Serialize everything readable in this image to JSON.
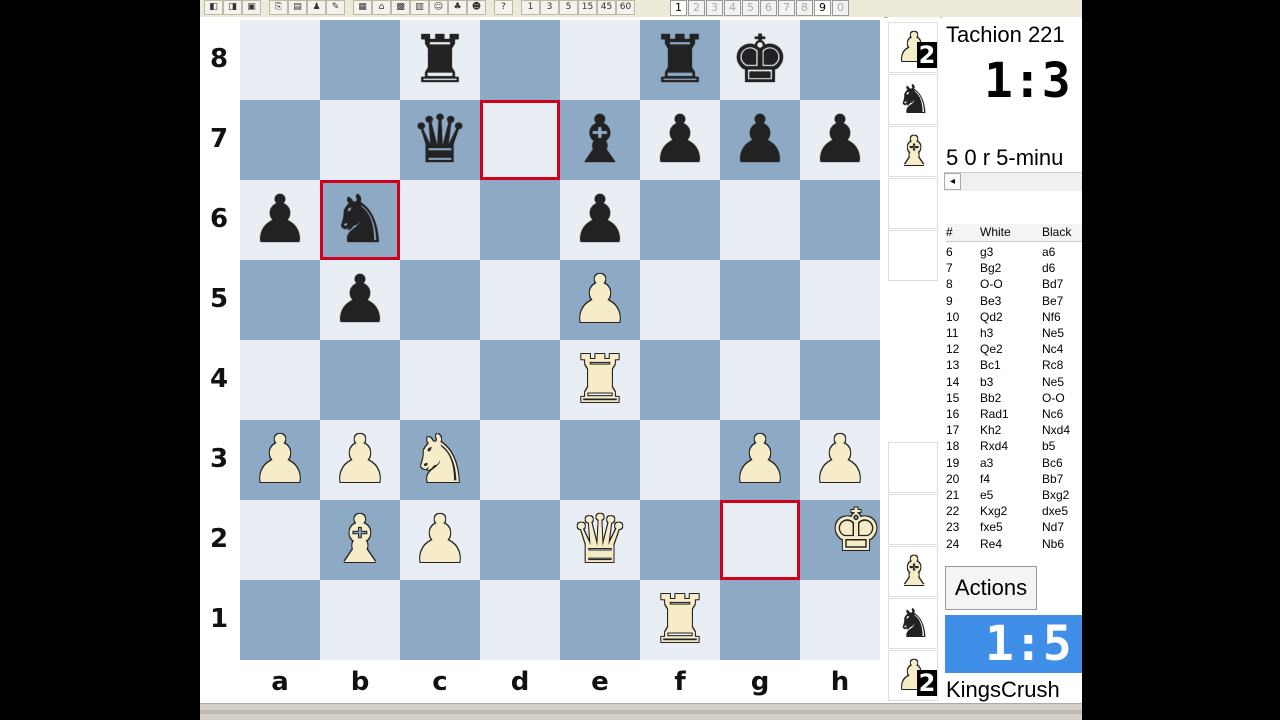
{
  "toolbar": {
    "icons": [
      {
        "name": "new-game-icon",
        "glyph": "◧"
      },
      {
        "name": "open-icon",
        "glyph": "◨"
      },
      {
        "name": "save-icon",
        "glyph": "▣"
      },
      {
        "name": "copy-icon",
        "glyph": "⎘"
      },
      {
        "name": "paste-icon",
        "glyph": "▤"
      },
      {
        "name": "engine-icon",
        "glyph": "♟"
      },
      {
        "name": "edit-icon",
        "glyph": "✎"
      },
      {
        "name": "list-icon",
        "glyph": "▦"
      },
      {
        "name": "home-icon",
        "glyph": "⌂"
      },
      {
        "name": "grid-icon",
        "glyph": "▩"
      },
      {
        "name": "board-icon",
        "glyph": "▥"
      },
      {
        "name": "person-icon",
        "glyph": "☺"
      },
      {
        "name": "tree-icon",
        "glyph": "♣"
      },
      {
        "name": "user-icon",
        "glyph": "☻"
      },
      {
        "name": "help-icon",
        "glyph": "?"
      },
      {
        "name": "level-1-icon",
        "glyph": "1"
      },
      {
        "name": "level-3-icon",
        "glyph": "3"
      },
      {
        "name": "level-5-icon",
        "glyph": "5"
      },
      {
        "name": "level-15-icon",
        "glyph": "15"
      },
      {
        "name": "level-45-icon",
        "glyph": "45"
      },
      {
        "name": "level-60-icon",
        "glyph": "60"
      }
    ],
    "numbers": [
      "1",
      "2",
      "3",
      "4",
      "5",
      "6",
      "7",
      "8",
      "9",
      "0"
    ],
    "active_numbers": [
      "1",
      "9"
    ]
  },
  "board": {
    "ranks": [
      "8",
      "7",
      "6",
      "5",
      "4",
      "3",
      "2",
      "1"
    ],
    "files": [
      "a",
      "b",
      "c",
      "d",
      "e",
      "f",
      "g",
      "h"
    ],
    "pieces": [
      {
        "sq": "c8",
        "color": "black",
        "glyph": "♜",
        "name": "black-rook-icon"
      },
      {
        "sq": "f8",
        "color": "black",
        "glyph": "♜",
        "name": "black-rook-icon"
      },
      {
        "sq": "g8",
        "color": "black",
        "glyph": "♚",
        "name": "black-king-icon"
      },
      {
        "sq": "c7",
        "color": "black",
        "glyph": "♛",
        "name": "black-queen-icon"
      },
      {
        "sq": "e7",
        "color": "black",
        "glyph": "♝",
        "name": "black-bishop-icon"
      },
      {
        "sq": "f7",
        "color": "black",
        "glyph": "♟",
        "name": "black-pawn-icon"
      },
      {
        "sq": "g7",
        "color": "black",
        "glyph": "♟",
        "name": "black-pawn-icon"
      },
      {
        "sq": "h7",
        "color": "black",
        "glyph": "♟",
        "name": "black-pawn-icon"
      },
      {
        "sq": "a6",
        "color": "black",
        "glyph": "♟",
        "name": "black-pawn-icon"
      },
      {
        "sq": "b6",
        "color": "black",
        "glyph": "♞",
        "name": "black-knight-icon"
      },
      {
        "sq": "e6",
        "color": "black",
        "glyph": "♟",
        "name": "black-pawn-icon"
      },
      {
        "sq": "b5",
        "color": "black",
        "glyph": "♟",
        "name": "black-pawn-icon"
      },
      {
        "sq": "e5",
        "color": "white",
        "glyph": "♟",
        "name": "white-pawn-icon"
      },
      {
        "sq": "e4",
        "color": "white",
        "glyph": "♜",
        "name": "white-rook-icon"
      },
      {
        "sq": "a3",
        "color": "white",
        "glyph": "♟",
        "name": "white-pawn-icon"
      },
      {
        "sq": "b3",
        "color": "white",
        "glyph": "♟",
        "name": "white-pawn-icon"
      },
      {
        "sq": "c3",
        "color": "white",
        "glyph": "♞",
        "name": "white-knight-icon"
      },
      {
        "sq": "g3",
        "color": "white",
        "glyph": "♟",
        "name": "white-pawn-icon"
      },
      {
        "sq": "h3",
        "color": "white",
        "glyph": "♟",
        "name": "white-pawn-icon"
      },
      {
        "sq": "b2",
        "color": "white",
        "glyph": "♝",
        "name": "white-bishop-icon"
      },
      {
        "sq": "c2",
        "color": "white",
        "glyph": "♟",
        "name": "white-pawn-icon"
      },
      {
        "sq": "e2",
        "color": "white",
        "glyph": "♛",
        "name": "white-queen-icon"
      },
      {
        "sq": "f1",
        "color": "white",
        "glyph": "♜",
        "name": "white-rook-icon"
      }
    ],
    "moving_piece": {
      "color": "white",
      "glyph": "♚",
      "name": "white-king-icon",
      "from": "g2",
      "to": "h2"
    },
    "highlights": [
      "d7",
      "b6",
      "g2"
    ]
  },
  "captured": {
    "top": [
      {
        "glyph": "♟",
        "color": "white",
        "count": "2",
        "name": "captured-white-pawn-icon"
      },
      {
        "glyph": "♞",
        "color": "black",
        "count": "",
        "name": "captured-black-knight-icon"
      },
      {
        "glyph": "♝",
        "color": "white",
        "count": "",
        "name": "captured-white-bishop-icon"
      }
    ],
    "bottom": [
      {
        "glyph": "♝",
        "color": "white",
        "count": "",
        "name": "captured-white-bishop-icon"
      },
      {
        "glyph": "♞",
        "color": "black",
        "count": "",
        "name": "captured-black-knight-icon"
      },
      {
        "glyph": "♟",
        "color": "white",
        "count": "2",
        "name": "captured-white-pawn-icon"
      }
    ]
  },
  "panel": {
    "top_player": "Tachion 221",
    "top_clock": "1:3",
    "game_info": "5 0 r 5-minu",
    "scroll_left": "◂",
    "actions_label": "Actions",
    "bottom_clock": "1:5",
    "bottom_player": "KingsCrush",
    "clock_active_color": "#3f8ee8"
  },
  "movelist": {
    "headers": [
      "#",
      "White",
      "Black"
    ],
    "rows": [
      [
        "6",
        "g3",
        "a6"
      ],
      [
        "7",
        "Bg2",
        "d6"
      ],
      [
        "8",
        "O-O",
        "Bd7"
      ],
      [
        "9",
        "Be3",
        "Be7"
      ],
      [
        "10",
        "Qd2",
        "Nf6"
      ],
      [
        "11",
        "h3",
        "Ne5"
      ],
      [
        "12",
        "Qe2",
        "Nc4"
      ],
      [
        "13",
        "Bc1",
        "Rc8"
      ],
      [
        "14",
        "b3",
        "Ne5"
      ],
      [
        "15",
        "Bb2",
        "O-O"
      ],
      [
        "16",
        "Rad1",
        "Nc6"
      ],
      [
        "17",
        "Kh2",
        "Nxd4"
      ],
      [
        "18",
        "Rxd4",
        "b5"
      ],
      [
        "19",
        "a3",
        "Bc6"
      ],
      [
        "20",
        "f4",
        "Bb7"
      ],
      [
        "21",
        "e5",
        "Bxg2"
      ],
      [
        "22",
        "Kxg2",
        "dxe5"
      ],
      [
        "23",
        "fxe5",
        "Nd7"
      ],
      [
        "24",
        "Re4",
        "Nb6"
      ]
    ]
  }
}
